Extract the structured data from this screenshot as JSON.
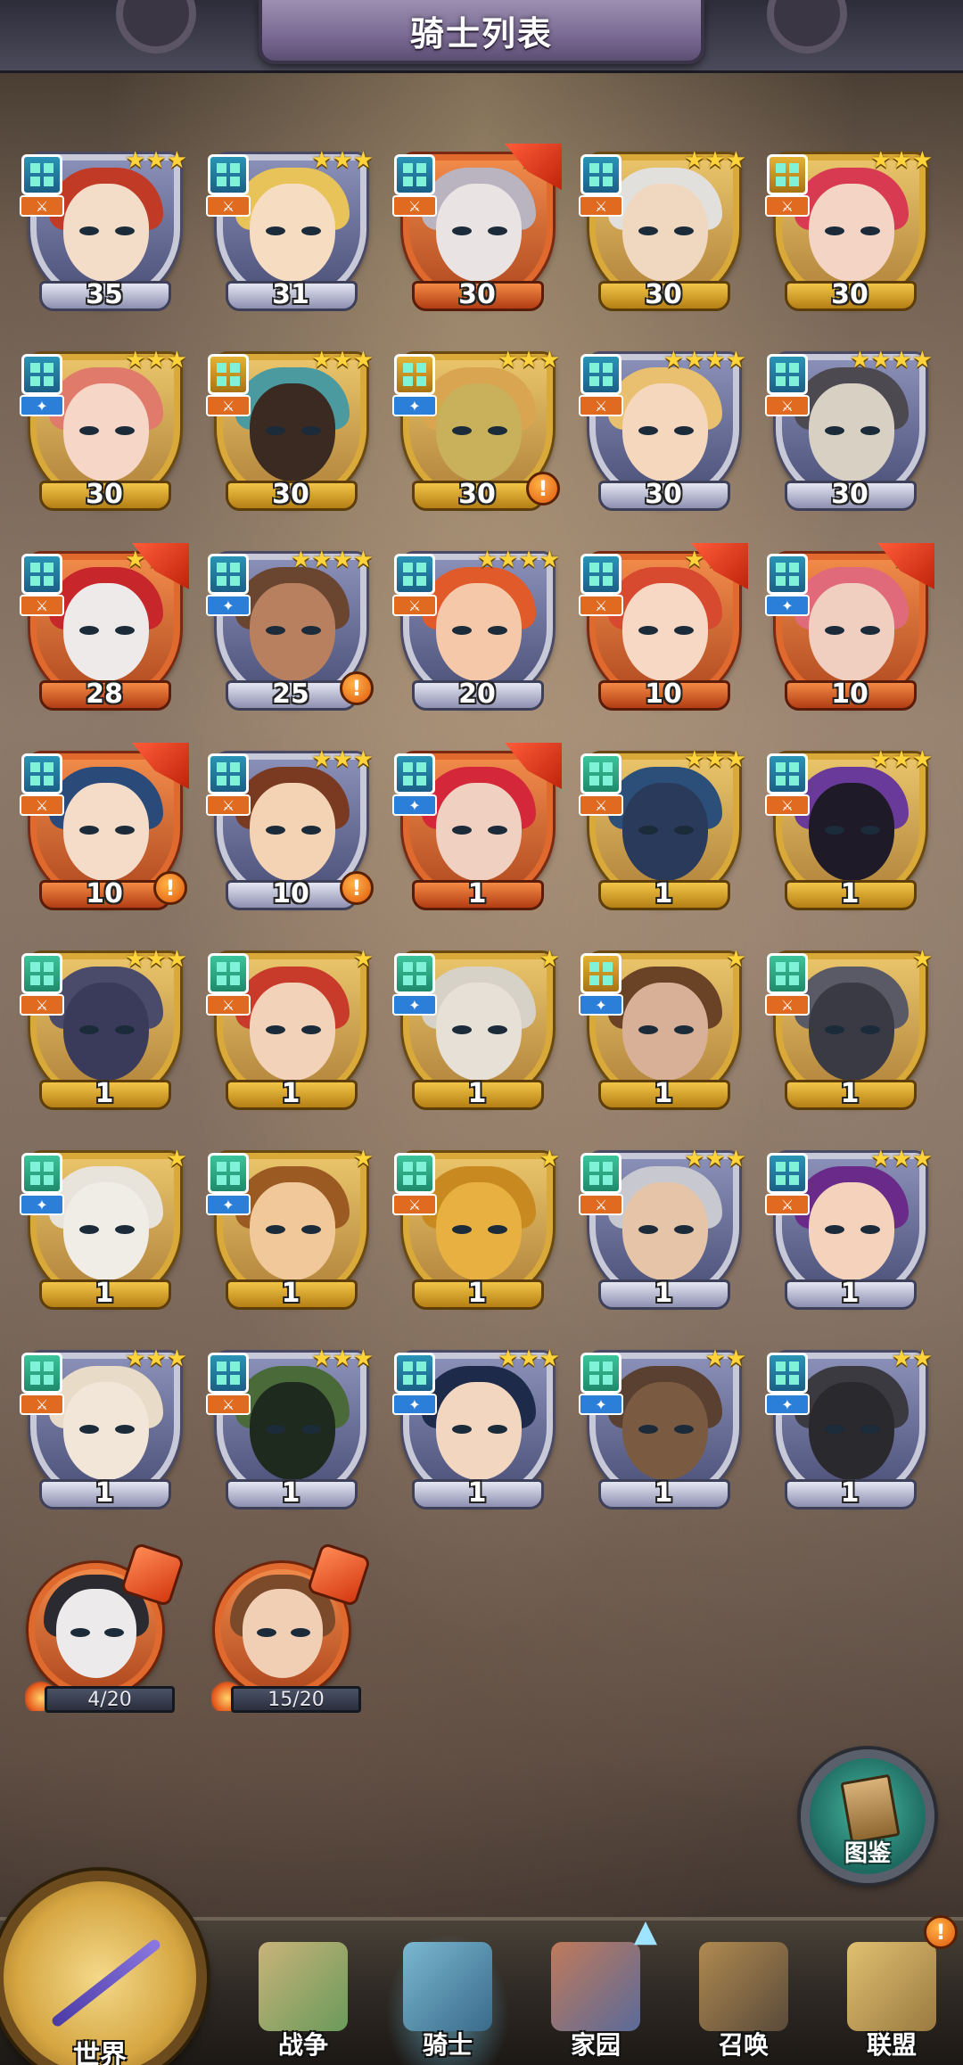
{
  "header": {
    "title": "骑士列表"
  },
  "knights": [
    {
      "level": "35",
      "stars": 3,
      "frame": "silver",
      "badge": "blue",
      "role": "orange",
      "skin": "#f3ddc8",
      "hair": "#c03a26",
      "alert": false,
      "flag": false
    },
    {
      "level": "31",
      "stars": 3,
      "frame": "silver",
      "badge": "blue",
      "role": "orange",
      "skin": "#f6dcc0",
      "hair": "#e8c35a",
      "alert": false,
      "flag": false
    },
    {
      "level": "30",
      "stars": 2,
      "frame": "red",
      "badge": "blue",
      "role": "orange",
      "skin": "#e9e3e3",
      "hair": "#b9b4c0",
      "alert": false,
      "flag": true
    },
    {
      "level": "30",
      "stars": 3,
      "frame": "gold",
      "badge": "blue",
      "role": "orange",
      "skin": "#f0d7bf",
      "hair": "#e2e0dc",
      "alert": false,
      "flag": false
    },
    {
      "level": "30",
      "stars": 3,
      "frame": "gold",
      "badge": "gold",
      "role": "orange",
      "skin": "#f4d4c4",
      "hair": "#d83a52",
      "alert": false,
      "flag": false
    },
    {
      "level": "30",
      "stars": 3,
      "frame": "gold",
      "badge": "blue",
      "role": "blue",
      "skin": "#f6d6c6",
      "hair": "#e07a6a",
      "alert": false,
      "flag": false
    },
    {
      "level": "30",
      "stars": 3,
      "frame": "gold",
      "badge": "gold",
      "role": "orange",
      "skin": "#3a2a22",
      "hair": "#4a9aa0",
      "alert": false,
      "flag": false
    },
    {
      "level": "30",
      "stars": 3,
      "frame": "gold",
      "badge": "gold",
      "role": "blue",
      "skin": "#c9b05a",
      "hair": "#d9a550",
      "alert": true,
      "flag": false
    },
    {
      "level": "30",
      "stars": 4,
      "frame": "silver",
      "badge": "blue",
      "role": "orange",
      "skin": "#f4d7bd",
      "hair": "#e8c070",
      "alert": false,
      "flag": false
    },
    {
      "level": "30",
      "stars": 4,
      "frame": "silver",
      "badge": "blue",
      "role": "orange",
      "skin": "#d9d0c4",
      "hair": "#4c4a50",
      "alert": false,
      "flag": false
    },
    {
      "level": "28",
      "stars": 3,
      "frame": "red",
      "badge": "blue",
      "role": "orange",
      "skin": "#eeeaea",
      "hair": "#c7262a",
      "alert": false,
      "flag": true
    },
    {
      "level": "25",
      "stars": 4,
      "frame": "silver",
      "badge": "blue",
      "role": "blue",
      "skin": "#b98060",
      "hair": "#6a4630",
      "alert": true,
      "flag": false
    },
    {
      "level": "20",
      "stars": 4,
      "frame": "silver",
      "badge": "blue",
      "role": "orange",
      "skin": "#f4c8a8",
      "hair": "#e05a2a",
      "alert": false,
      "flag": false
    },
    {
      "level": "10",
      "stars": 3,
      "frame": "red",
      "badge": "blue",
      "role": "orange",
      "skin": "#f6d8c4",
      "hair": "#d84a30",
      "alert": false,
      "flag": true
    },
    {
      "level": "10",
      "stars": 2,
      "frame": "red",
      "badge": "blue",
      "role": "blue",
      "skin": "#f0cfc0",
      "hair": "#e06a7a",
      "alert": false,
      "flag": true
    },
    {
      "level": "10",
      "stars": 1,
      "frame": "red",
      "badge": "blue",
      "role": "orange",
      "skin": "#f4dcc8",
      "hair": "#2a4a7a",
      "alert": true,
      "flag": true
    },
    {
      "level": "10",
      "stars": 3,
      "frame": "silver",
      "badge": "blue",
      "role": "orange",
      "skin": "#f4d2b4",
      "hair": "#7a3a22",
      "alert": true,
      "flag": false
    },
    {
      "level": "1",
      "stars": 1,
      "frame": "red",
      "badge": "blue",
      "role": "blue",
      "skin": "#f0d0c0",
      "hair": "#d4283a",
      "alert": false,
      "flag": true
    },
    {
      "level": "1",
      "stars": 3,
      "frame": "gold",
      "badge": "green",
      "role": "orange",
      "skin": "#2a3a5a",
      "hair": "#2c4f7a",
      "alert": false,
      "flag": false
    },
    {
      "level": "1",
      "stars": 3,
      "frame": "gold",
      "badge": "blue",
      "role": "orange",
      "skin": "#1e1a28",
      "hair": "#6a3a9a",
      "alert": false,
      "flag": false
    },
    {
      "level": "1",
      "stars": 3,
      "frame": "gold",
      "badge": "green",
      "role": "orange",
      "skin": "#3a3a5a",
      "hair": "#4a4a6a",
      "alert": false,
      "flag": false
    },
    {
      "level": "1",
      "stars": 1,
      "frame": "gold",
      "badge": "green",
      "role": "orange",
      "skin": "#f2d2b8",
      "hair": "#c83a2a",
      "alert": false,
      "flag": false
    },
    {
      "level": "1",
      "stars": 1,
      "frame": "gold",
      "badge": "green",
      "role": "blue",
      "skin": "#e6e0d6",
      "hair": "#d6d2c8",
      "alert": false,
      "flag": false
    },
    {
      "level": "1",
      "stars": 1,
      "frame": "gold",
      "badge": "gold",
      "role": "blue",
      "skin": "#d8b098",
      "hair": "#6a4226",
      "alert": false,
      "flag": false
    },
    {
      "level": "1",
      "stars": 1,
      "frame": "gold",
      "badge": "green",
      "role": "orange",
      "skin": "#3a3a44",
      "hair": "#5a5a66",
      "alert": false,
      "flag": false
    },
    {
      "level": "1",
      "stars": 1,
      "frame": "gold",
      "badge": "green",
      "role": "blue",
      "skin": "#f0ece6",
      "hair": "#e8e4dc",
      "alert": false,
      "flag": false
    },
    {
      "level": "1",
      "stars": 1,
      "frame": "gold",
      "badge": "green",
      "role": "blue",
      "skin": "#f0c89a",
      "hair": "#9a5a22",
      "alert": false,
      "flag": false
    },
    {
      "level": "1",
      "stars": 1,
      "frame": "gold",
      "badge": "green",
      "role": "orange",
      "skin": "#e8b040",
      "hair": "#c88a20",
      "alert": false,
      "flag": false
    },
    {
      "level": "1",
      "stars": 3,
      "frame": "silver",
      "badge": "green",
      "role": "orange",
      "skin": "#e6c4a8",
      "hair": "#c8c8d0",
      "alert": false,
      "flag": false
    },
    {
      "level": "1",
      "stars": 3,
      "frame": "silver",
      "badge": "blue",
      "role": "orange",
      "skin": "#f4d2bc",
      "hair": "#6a2a8a",
      "alert": false,
      "flag": false
    },
    {
      "level": "1",
      "stars": 3,
      "frame": "silver",
      "badge": "green",
      "role": "orange",
      "skin": "#f2e6d8",
      "hair": "#e8dcc8",
      "alert": false,
      "flag": false
    },
    {
      "level": "1",
      "stars": 3,
      "frame": "silver",
      "badge": "blue",
      "role": "orange",
      "skin": "#1e2a1e",
      "hair": "#4a6a3a",
      "alert": false,
      "flag": false
    },
    {
      "level": "1",
      "stars": 3,
      "frame": "silver",
      "badge": "blue",
      "role": "blue",
      "skin": "#f2d6c0",
      "hair": "#1e2a4a",
      "alert": false,
      "flag": false
    },
    {
      "level": "1",
      "stars": 2,
      "frame": "silver",
      "badge": "green",
      "role": "blue",
      "skin": "#7a5a40",
      "hair": "#5a4030",
      "alert": false,
      "flag": false
    },
    {
      "level": "1",
      "stars": 2,
      "frame": "silver",
      "badge": "blue",
      "role": "blue",
      "skin": "#2a2a2e",
      "hair": "#3a3a40",
      "alert": false,
      "flag": false
    }
  ],
  "shards": [
    {
      "progress": "4/20",
      "skin": "#eceaea",
      "hair": "#2a2a30"
    },
    {
      "progress": "15/20",
      "skin": "#f0cfb4",
      "hair": "#7a4a2a"
    }
  ],
  "codex": {
    "label": "图鉴"
  },
  "nav": {
    "world": "世界",
    "war": "战争",
    "knight": "骑士",
    "home": "家园",
    "summon": "召唤",
    "alliance": "联盟",
    "alert": "!"
  },
  "colors": {
    "gold": "#d9a93a",
    "silver": "#c8c9d8",
    "red": "#e0692e",
    "accent_blue": "#2b7fd8",
    "accent_orange": "#e06a1f"
  }
}
